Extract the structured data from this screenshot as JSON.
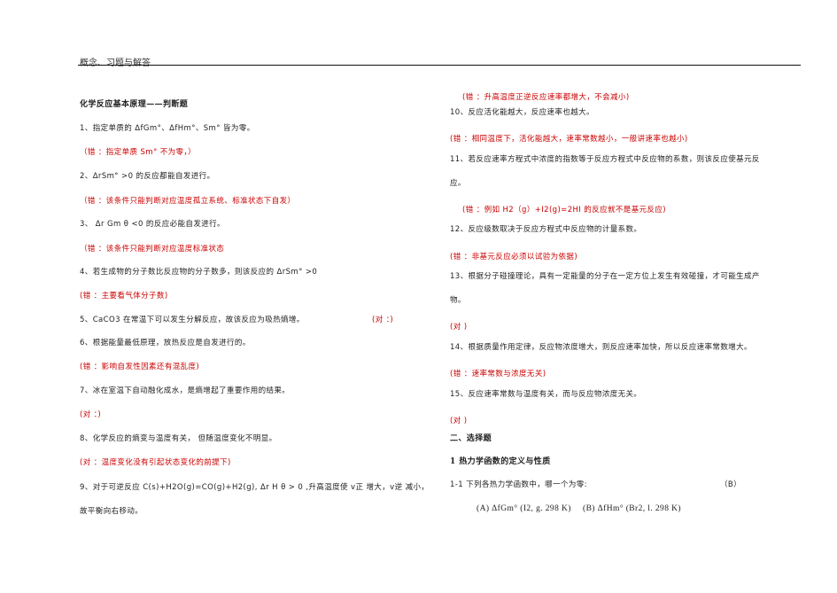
{
  "header": {
    "title": "概念、习题与解答"
  },
  "left": {
    "section_title": "化学反应基本原理——判断题",
    "q1": "1、指定单质的 ΔfGm°、ΔfHm°、Sm° 皆为零。",
    "a1": "（错  ：指定单质 Sm° 不为零，）",
    "q2": "2、ΔrSm° >0 的反应都能自发进行。",
    "a2": "（错  ：该条件只能判断对应温度孤立系统、标准状态下自发）",
    "q3": "3、 Δr Gm θ <0 的反应必能自发进行。",
    "a3": "（错  ：该条件只能判断对应温度标准状态",
    "q4": "4、若生成物的分子数比反应物的分子数多，则该反应的 ΔrSm° >0",
    "a4": "(错  ：主要看气体分子数)",
    "q5": "5、CaCO3 在常温下可以发生分解反应，故该反应为吸热熵增。",
    "a5": "(对  ：)",
    "q6": "6、根据能量最低原理，放热反应是自发进行的。",
    "a6": "(错  ：影响自发性因素还有混乱度)",
    "q7": "7、冰在室温下自动融化成水，是熵增起了重要作用的结果。",
    "a7": "(对  ：)",
    "q8": "8、化学反应的熵变与温度有关，  但随温度变化不明显。",
    "a8": "(对  ：温度变化没有引起状态变化的前提下)",
    "q9a": "9、对于可逆反应 C(s)+H2O(g)=CO(g)+H2(g), Δr H θ > 0 ,升高温度使 v正 增大，v逆 减小，",
    "q9b": "故平衡向右移动。"
  },
  "right": {
    "a9": "(错  ：升高温度正逆反应速率都增大，不会减小)",
    "q10": "10、反应活化能越大，反应速率也越大。",
    "a10": "(错  ：相同温度下，活化能越大，速率常数越小，一般讲速率也越小)",
    "q11a": "11、若反应速率方程式中浓度的指数等于反应方程式中反应物的系数，则该反应使基元反",
    "q11b": "应。",
    "a11": "(错  ：例如 H2（g）+I2(g)=2HI 的反应就不是基元反应)",
    "q12": "12、反应级数取决于反应方程式中反应物的计量系数。",
    "a12": "(错  ：非基元反应必须以试验为依据)",
    "q13a": "13、根据分子碰撞理论，具有一定能量的分子在一定方位上发生有效碰撞，才可能生成产",
    "q13b": "物。",
    "a13": "(对  )",
    "q14": "14、根据质量作用定律，反应物浓度增大，则反应速率加快，所以反应速率常数增大。",
    "a14": "(错  ：速率常数与浓度无关)",
    "q15": "15、反应速率常数与温度有关，而与反应物浓度无关。",
    "a15": "(对  )",
    "section2": "二、选择题",
    "subsection": "1 热力学函数的定义与性质",
    "q11_1": "1-1 下列各热力学函数中，哪一个为零:",
    "answer": "（B）",
    "optA": "(A) ΔfGm° (I2, g. 298 K)",
    "optB": "(B) ΔfHm° (Br2, l. 298 K)"
  }
}
